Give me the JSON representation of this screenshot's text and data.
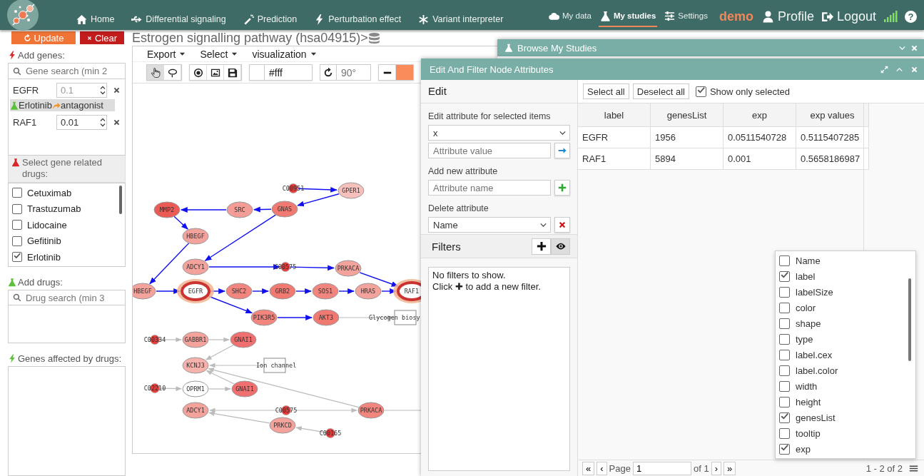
{
  "nav": {
    "main_links": [
      {
        "label": "Home"
      },
      {
        "label": "Differential signaling"
      },
      {
        "label": "Prediction"
      },
      {
        "label": "Perturbation effect"
      },
      {
        "label": "Variant interpreter"
      }
    ],
    "study_links": [
      {
        "label": "My data",
        "selected": false
      },
      {
        "label": "My studies",
        "selected": true
      },
      {
        "label": "Settings",
        "selected": false
      }
    ],
    "user": "demo",
    "account_links": [
      {
        "label": "Profile"
      },
      {
        "label": "Logout"
      }
    ],
    "help": "?"
  },
  "sidebar": {
    "buttons": [
      {
        "label": "Update",
        "kind": "update"
      },
      {
        "label": "Clear",
        "kind": "clear"
      }
    ],
    "add_genes": {
      "title": "Add genes:",
      "placeholder": "Gene search (min 2"
    },
    "genes": [
      {
        "name": "EGFR",
        "placeholder": "0.1",
        "drugs": [
          {
            "name": "Erlotinib",
            "effect": "antagonist"
          }
        ]
      },
      {
        "name": "RAF1",
        "value": "0.01"
      }
    ],
    "related_drugs": {
      "title": "Select gene related drugs:",
      "items": [
        {
          "label": "Cetuximab",
          "checked": false
        },
        {
          "label": "Trastuzumab",
          "checked": false
        },
        {
          "label": "Lidocaine",
          "checked": false
        },
        {
          "label": "Gefitinib",
          "checked": false
        },
        {
          "label": "Erlotinib",
          "checked": true
        }
      ]
    },
    "add_drugs": {
      "title": "Add drugs:",
      "placeholder": "Drug search (min 3"
    },
    "affected": {
      "title": "Genes affected by drugs:"
    }
  },
  "graph": {
    "title": "Estrogen signalling pathway (hsa04915)>",
    "menus": [
      "Export",
      "Select",
      "visualization"
    ],
    "tools": [
      {
        "selected": true
      },
      {
        "selected": false
      }
    ],
    "background": "#fff",
    "rotation_placeholder": "90°",
    "nodes": [
      {
        "label": "C00951",
        "kind": "compound",
        "color": "#e83c3c"
      },
      {
        "label": "GPER1",
        "kind": "gene",
        "color": "#f6c1bd",
        "selected": false
      },
      {
        "label": "MMP2",
        "kind": "gene",
        "color": "#ec5a55",
        "selected": false
      },
      {
        "label": "SRC",
        "kind": "gene",
        "color": "#f49c96",
        "selected": false
      },
      {
        "label": "GNAS",
        "kind": "gene",
        "color": "#f07a72",
        "selected": false
      },
      {
        "label": "HBEGF",
        "kind": "gene",
        "color": "#f4a29c",
        "selected": false
      },
      {
        "label": "ADCY1",
        "kind": "gene",
        "color": "#f4a29c",
        "selected": false
      },
      {
        "label": "C00575",
        "kind": "compound",
        "color": "#e83c3c"
      },
      {
        "label": "PRKACA",
        "kind": "gene",
        "color": "#f4a29c",
        "selected": false
      },
      {
        "label": "HBEGF",
        "kind": "gene",
        "color": "#f4a29c",
        "selected": false
      },
      {
        "label": "EGFR",
        "kind": "gene",
        "color": "#ffffff",
        "selected": true
      },
      {
        "label": "SHC2",
        "kind": "gene",
        "color": "#f2867e",
        "selected": false
      },
      {
        "label": "GRB2",
        "kind": "gene",
        "color": "#f07a72",
        "selected": false
      },
      {
        "label": "SOS1",
        "kind": "gene",
        "color": "#f2867e",
        "selected": false
      },
      {
        "label": "HRAS",
        "kind": "gene",
        "color": "#f4a29c",
        "selected": false
      },
      {
        "label": "RAF1",
        "kind": "gene",
        "color": "#ffffff",
        "selected": true
      },
      {
        "label": "PIK3R5",
        "kind": "gene",
        "color": "#f2867e",
        "selected": false
      },
      {
        "label": "AKT3",
        "kind": "gene",
        "color": "#f07a72",
        "selected": false
      },
      {
        "label": "Glycogen biosy",
        "kind": "process"
      },
      {
        "label": "C00334",
        "kind": "compound",
        "color": "#e83c3c"
      },
      {
        "label": "GABBR1",
        "kind": "gene",
        "color": "#f4a29c",
        "selected": false
      },
      {
        "label": "GNAI1",
        "kind": "gene",
        "color": "#f07070",
        "selected": false
      },
      {
        "label": "KCNJ3",
        "kind": "gene",
        "color": "#f7b2ac",
        "selected": false
      },
      {
        "label": "Ion channel",
        "kind": "process"
      },
      {
        "label": "C02210",
        "kind": "compound",
        "color": "#e83c3c"
      },
      {
        "label": "OPRM1",
        "kind": "gene",
        "color": "#ffffff",
        "selected": false
      },
      {
        "label": "GNAI1",
        "kind": "gene",
        "color": "#f07070",
        "selected": false
      },
      {
        "label": "ADCY1",
        "kind": "gene",
        "color": "#f4a29c",
        "selected": false
      },
      {
        "label": "C00575",
        "kind": "compound",
        "color": "#e83c3c"
      },
      {
        "label": "PRKACA",
        "kind": "gene",
        "color": "#f2867e",
        "selected": false
      },
      {
        "label": "PRKCD",
        "kind": "gene",
        "color": "#f4a29c",
        "selected": false
      },
      {
        "label": "C00165",
        "kind": "compound",
        "color": "#e83c3c"
      }
    ]
  },
  "browse_window": {
    "title": "Browse My Studies"
  },
  "edit_window": {
    "title": "Edit And Filter Node Attributes",
    "edit": {
      "title": "Edit",
      "attr_label": "Edit attribute for selected items",
      "attr_select": "x",
      "value_placeholder": "Attribute value",
      "new_label": "Add new attribute",
      "name_placeholder": "Attribute name",
      "delete_label": "Delete attribute",
      "delete_select": "Name"
    },
    "filters": {
      "title": "Filters",
      "eye_on": true,
      "lines": [
        "No filters to show.",
        "Click ✚ to add a new filter."
      ]
    },
    "table": {
      "buttons": [
        "Select all",
        "Deselect all"
      ],
      "show_only_selected": {
        "label": "Show only selected",
        "checked": true
      },
      "columns": [
        "label",
        "genesList",
        "exp",
        "exp values"
      ],
      "rows": [
        [
          "EGFR",
          "1956",
          "0.0511540728",
          "0.5115407285"
        ],
        [
          "RAF1",
          "5894",
          "0.001",
          "0.5658186987"
        ]
      ]
    },
    "column_menu": [
      {
        "label": "Name",
        "checked": false
      },
      {
        "label": "label",
        "checked": true
      },
      {
        "label": "labelSize",
        "checked": false
      },
      {
        "label": "color",
        "checked": false
      },
      {
        "label": "shape",
        "checked": false
      },
      {
        "label": "type",
        "checked": false
      },
      {
        "label": "label.cex",
        "checked": false
      },
      {
        "label": "label.color",
        "checked": false
      },
      {
        "label": "width",
        "checked": false
      },
      {
        "label": "height",
        "checked": false
      },
      {
        "label": "genesList",
        "checked": true
      },
      {
        "label": "tooltip",
        "checked": false
      },
      {
        "label": "exp",
        "checked": true
      }
    ],
    "pager": {
      "first": "«",
      "prev": "‹",
      "page_label": "Page",
      "page": "1",
      "of": "of 1",
      "next": "›",
      "last": "»",
      "summary": "1 - 2 of 2"
    }
  }
}
